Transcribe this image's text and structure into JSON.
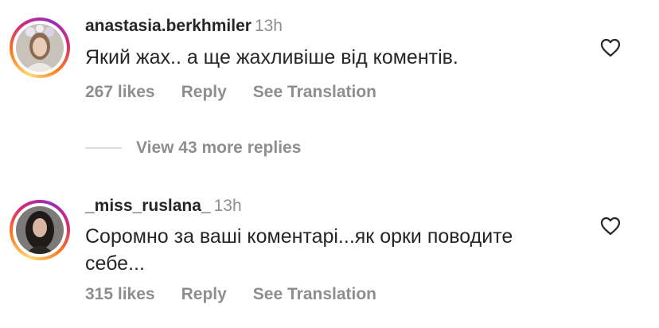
{
  "comments": [
    {
      "username": "anastasia.berkhmiler",
      "time": "13h",
      "text": "Який жах.. а ще жахливіше від коментів.",
      "likes": "267 likes",
      "reply": "Reply",
      "translate": "See Translation"
    },
    {
      "username": "_miss_ruslana_",
      "time": "13h",
      "text": "Соромно за ваші коментарі...як орки поводите себе...",
      "likes": "315 likes",
      "reply": "Reply",
      "translate": "See Translation"
    }
  ],
  "view_replies": "View 43 more replies",
  "colors": {
    "text": "#262626",
    "secondary": "#8e8e8e",
    "divider": "#dbdbdb"
  },
  "icons": [
    "heart-icon",
    "avatar"
  ]
}
